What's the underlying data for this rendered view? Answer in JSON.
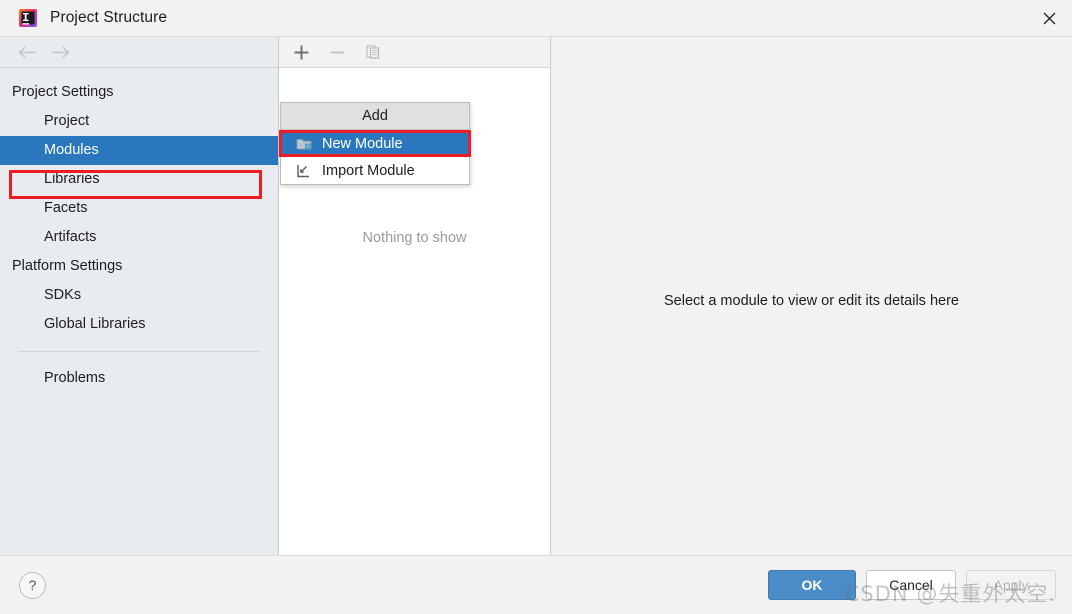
{
  "window": {
    "title": "Project Structure",
    "app_icon": "intellij-idea-icon",
    "close_icon": "close-icon"
  },
  "sidebar": {
    "back_icon": "arrow-left-icon",
    "forward_icon": "arrow-right-icon",
    "groups": [
      {
        "label": "Project Settings",
        "items": [
          {
            "label": "Project",
            "selected": false
          },
          {
            "label": "Modules",
            "selected": true
          },
          {
            "label": "Libraries",
            "selected": false
          },
          {
            "label": "Facets",
            "selected": false
          },
          {
            "label": "Artifacts",
            "selected": false
          }
        ]
      },
      {
        "label": "Platform Settings",
        "items": [
          {
            "label": "SDKs",
            "selected": false
          },
          {
            "label": "Global Libraries",
            "selected": false
          }
        ]
      }
    ],
    "extra_items": [
      {
        "label": "Problems"
      }
    ]
  },
  "module_panel": {
    "toolbar": {
      "add_icon": "plus-icon",
      "remove_icon": "minus-icon",
      "copy_icon": "copy-icon"
    },
    "empty_text": "Nothing to show"
  },
  "detail_panel": {
    "empty_text": "Select a module to view or edit its details here"
  },
  "add_popup": {
    "header": "Add",
    "items": [
      {
        "label": "New Module",
        "icon": "module-folder-icon",
        "active": true
      },
      {
        "label": "Import Module",
        "icon": "import-arrow-icon",
        "active": false
      }
    ]
  },
  "footer": {
    "help_label": "?",
    "help_icon": "question-mark-icon",
    "buttons": [
      {
        "label": "OK",
        "style": "primary"
      },
      {
        "label": "Cancel",
        "style": "default"
      },
      {
        "label": "Apply",
        "style": "disabled"
      }
    ]
  },
  "watermark": {
    "text": "CSDN @失重外太空."
  },
  "colors": {
    "selection_blue": "#2a77be",
    "highlight_red": "#ee1c25",
    "ok_button_blue": "#4a8cc8",
    "sidebar_bg": "#e8ecf0",
    "panel_bg": "#f2f2f2"
  }
}
